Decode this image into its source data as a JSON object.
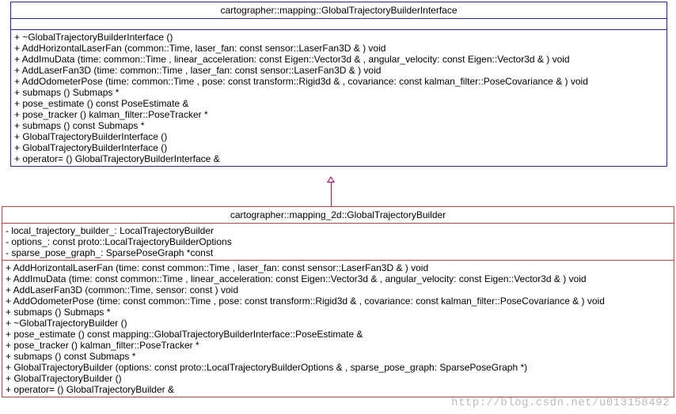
{
  "interface_class": {
    "title": "cartographer::mapping::GlobalTrajectoryBuilderInterface",
    "members": [
      "+ ~GlobalTrajectoryBuilderInterface ()",
      "+ AddHorizontalLaserFan (common::Time, laser_fan: const sensor::LaserFan3D & ) void",
      "+ AddImuData (time: common::Time , linear_acceleration: const Eigen::Vector3d & , angular_velocity: const Eigen::Vector3d & ) void",
      "+ AddLaserFan3D (time: common::Time , laser_fan: const sensor::LaserFan3D & ) void",
      "+ AddOdometerPose (time: common::Time , pose: const transform::Rigid3d & , covariance: const kalman_filter::PoseCovariance & ) void",
      "+ submaps () Submaps *",
      "+ pose_estimate () const PoseEstimate &",
      "+ pose_tracker () kalman_filter::PoseTracker *",
      "+ submaps () const Submaps *",
      "+ GlobalTrajectoryBuilderInterface ()",
      "+ GlobalTrajectoryBuilderInterface ()",
      "+ operator= () GlobalTrajectoryBuilderInterface &"
    ]
  },
  "impl_class": {
    "title": "cartographer::mapping_2d::GlobalTrajectoryBuilder",
    "fields": [
      "- local_trajectory_builder_: LocalTrajectoryBuilder",
      "- options_: const proto::LocalTrajectoryBuilderOptions",
      "- sparse_pose_graph_: SparsePoseGraph *const"
    ],
    "members": [
      "+ AddHorizontalLaserFan (time: const common::Time , laser_fan: const sensor::LaserFan3D & ) void",
      "+ AddImuData (time: const common::Time , linear_acceleration: const Eigen::Vector3d & , angular_velocity: const Eigen::Vector3d & ) void",
      "+ AddLaserFan3D (common::Time, sensor: const ) void",
      "+ AddOdometerPose (time: const common::Time , pose: const transform::Rigid3d & , covariance: const kalman_filter::PoseCovariance & ) void",
      "+ submaps () Submaps *",
      "+ ~GlobalTrajectoryBuilder ()",
      "+ pose_estimate () const mapping::GlobalTrajectoryBuilderInterface::PoseEstimate &",
      "+ pose_tracker () kalman_filter::PoseTracker *",
      "+ submaps () const Submaps *",
      "+ GlobalTrajectoryBuilder (options: const proto::LocalTrajectoryBuilderOptions & , sparse_pose_graph: SparsePoseGraph *)",
      "+ GlobalTrajectoryBuilder ()",
      "+ operator= () GlobalTrajectoryBuilder &"
    ]
  },
  "watermark": "http://blog.csdn.net/u013158492",
  "chart_data": {
    "type": "uml_class_diagram",
    "classes": [
      {
        "name": "cartographer::mapping::GlobalTrajectoryBuilderInterface",
        "role": "interface",
        "attributes": [],
        "operations": [
          "~GlobalTrajectoryBuilderInterface()",
          "AddHorizontalLaserFan(common::Time, const sensor::LaserFan3D &) : void",
          "AddImuData(time: common::Time, linear_acceleration: const Eigen::Vector3d &, angular_velocity: const Eigen::Vector3d &) : void",
          "AddLaserFan3D(time: common::Time, laser_fan: const sensor::LaserFan3D &) : void",
          "AddOdometerPose(time: common::Time, pose: const transform::Rigid3d &, covariance: const kalman_filter::PoseCovariance &) : void",
          "submaps() : Submaps *",
          "pose_estimate() : const PoseEstimate &",
          "pose_tracker() : kalman_filter::PoseTracker *",
          "submaps() : const Submaps *",
          "GlobalTrajectoryBuilderInterface()",
          "GlobalTrajectoryBuilderInterface()",
          "operator=() : GlobalTrajectoryBuilderInterface &"
        ]
      },
      {
        "name": "cartographer::mapping_2d::GlobalTrajectoryBuilder",
        "role": "concrete",
        "attributes": [
          "local_trajectory_builder_: LocalTrajectoryBuilder",
          "options_: const proto::LocalTrajectoryBuilderOptions",
          "sparse_pose_graph_: SparsePoseGraph *const"
        ],
        "operations": [
          "AddHorizontalLaserFan(time: const common::Time, laser_fan: const sensor::LaserFan3D &) : void",
          "AddImuData(time: const common::Time, linear_acceleration: const Eigen::Vector3d &, angular_velocity: const Eigen::Vector3d &) : void",
          "AddLaserFan3D(common::Time, sensor: const) : void",
          "AddOdometerPose(time: const common::Time, pose: const transform::Rigid3d &, covariance: const kalman_filter::PoseCovariance &) : void",
          "submaps() : Submaps *",
          "~GlobalTrajectoryBuilder()",
          "pose_estimate() : const mapping::GlobalTrajectoryBuilderInterface::PoseEstimate &",
          "pose_tracker() : kalman_filter::PoseTracker *",
          "submaps() : const Submaps *",
          "GlobalTrajectoryBuilder(options: const proto::LocalTrajectoryBuilderOptions &, sparse_pose_graph: SparsePoseGraph *)",
          "GlobalTrajectoryBuilder()",
          "operator=() : GlobalTrajectoryBuilder &"
        ]
      }
    ],
    "relationships": [
      {
        "type": "generalization",
        "from": "cartographer::mapping_2d::GlobalTrajectoryBuilder",
        "to": "cartographer::mapping::GlobalTrajectoryBuilderInterface"
      }
    ]
  }
}
